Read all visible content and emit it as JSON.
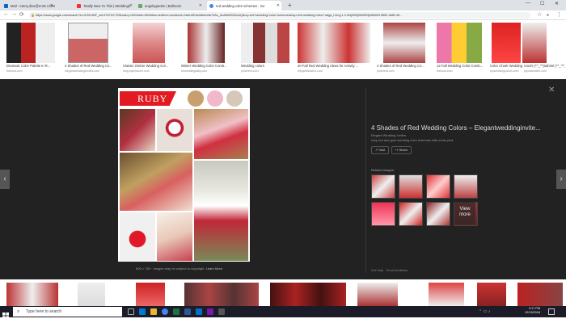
{
  "tabs": [
    {
      "label": "Mail - eterry.diaz@LIVE.COM",
      "color": "#0a64c8",
      "active": false
    },
    {
      "label": "Totally New To This | Weddings",
      "color": "#e33",
      "active": false
    },
    {
      "label": "angelsgarden | Ballroom",
      "color": "#6a6",
      "active": false
    },
    {
      "label": "red wedding color schemes - Go",
      "color": "#4285f4",
      "active": true
    }
  ],
  "address": {
    "url": "https://www.google.com/search?ei=IC5CHBF_zeL5767UCT6Sbw&q=1920&bih=969&biw=ie&tbm=isch&ved=0ahUKEwiA8b0o0kl79Ac_AxAW8G0DoAQ&oq=red+wedding+color+schemes&sq=red+wedding+color+s&gs_l=img.1.0.0l4j0i30j0i5i30l3j0i8i30l3.5552.4680.45..."
  },
  "thumbnails_top": [
    {
      "title": "Dramatic Color Palette in R...",
      "source": "theknot.com",
      "color": "#b22"
    },
    {
      "title": "4 Shades of Red Wedding Co...",
      "source": "elegantweddinginvites.com",
      "color": "#c66"
    },
    {
      "title": "Classic Ombre Wedding Col...",
      "source": "blog.stylehaven.com",
      "color": "#d88"
    },
    {
      "title": "Winter Wedding Color Comb...",
      "source": "beweddingdaily.com",
      "color": "#a33"
    },
    {
      "title": "Wedding colors",
      "source": "pinterest.com",
      "color": "#833"
    },
    {
      "title": "40 Fall Red Wedding Ideas for Activity ...",
      "source": "elegantflowers.com",
      "color": "#c33"
    },
    {
      "title": "4 Shades of Red Wedding Co...",
      "source": "pinterest.com",
      "color": "#a44"
    },
    {
      "title": "12 Fall Wedding Color Comb...",
      "source": "theknot.com",
      "color": "#e7a"
    },
    {
      "title": "Color Chart! Wedding Color Combi...",
      "source": "myweddingcolors.com",
      "color": "#d22"
    },
    {
      "title": "roochi (*^_^*)sahriel (*^_^*)ights ...",
      "source": "joyofwedded.com",
      "color": "#b33"
    }
  ],
  "viewer": {
    "ruby_label": "RUBY",
    "swatch_colors": [
      "#c8a070",
      "#f0b8c8",
      "#d6c8b8"
    ],
    "image_meta": "600 × 789 · Images may be subject to copyright.",
    "learn_more": "Learn More",
    "title": "4 Shades of Red Wedding Colors – Elegantweddinginvite...",
    "source": "Elegant Wedding Invites",
    "description": "ruby red and gold wedding color schemes with some pink",
    "visit_label": "Visit",
    "share_label": "Share",
    "related_label": "Related images:",
    "view_more_label": "View more",
    "help_links": "Get help · Send feedback",
    "related_colors": [
      "#c44",
      "#ddd",
      "#d33",
      "#b44",
      "#e35",
      "#c22",
      "#822",
      "#a33"
    ]
  },
  "thumbnails_bottom": [
    {
      "color": "#b33"
    },
    {
      "color": "#ddd"
    },
    {
      "color": "#c22"
    },
    {
      "color": "#533"
    },
    {
      "color": "#411"
    },
    {
      "color": "#a33"
    },
    {
      "color": "#d44"
    },
    {
      "color": "#c33"
    },
    {
      "color": "#b22"
    },
    {
      "color": "#844"
    }
  ],
  "taskbar": {
    "search_placeholder": "Type here to search",
    "time": "2:17 PM",
    "date": "12/13/2018"
  }
}
